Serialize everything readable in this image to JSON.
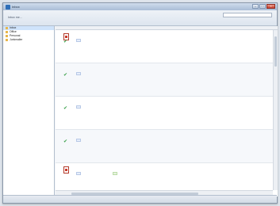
{
  "window": {
    "title": "Inbox"
  },
  "toolbar": {
    "breadcrumb": "Inbox me...",
    "search_placeholder": "",
    "sub_text": ""
  },
  "sidebar": {
    "folders": [
      {
        "label": "Inbox"
      },
      {
        "label": "Office"
      },
      {
        "label": "Personal"
      },
      {
        "label": "Junkmailer"
      }
    ]
  },
  "columns": {
    "c1": "",
    "c2": ""
  },
  "rows": [
    {
      "subject": "",
      "tag": "",
      "tag2": "",
      "from": "",
      "mid": "",
      "right": "",
      "status": "",
      "time": ""
    },
    {
      "subject": "",
      "tag": "",
      "tag2": "",
      "from": "",
      "mid": "",
      "right": "",
      "status": "",
      "time": ""
    },
    {
      "subject": "",
      "tag": "",
      "tag2": "",
      "from": "",
      "mid": "",
      "right": "",
      "status": "",
      "time": ""
    },
    {
      "subject": "",
      "tag": "",
      "tag2": "",
      "from": "",
      "mid": "",
      "right": "",
      "status": "",
      "time": ""
    },
    {
      "subject": "",
      "tag": "",
      "tag2": "",
      "from": "",
      "mid": "",
      "right": "",
      "status": "",
      "time": ""
    }
  ],
  "statusbar": {
    "left": "",
    "right": ""
  }
}
